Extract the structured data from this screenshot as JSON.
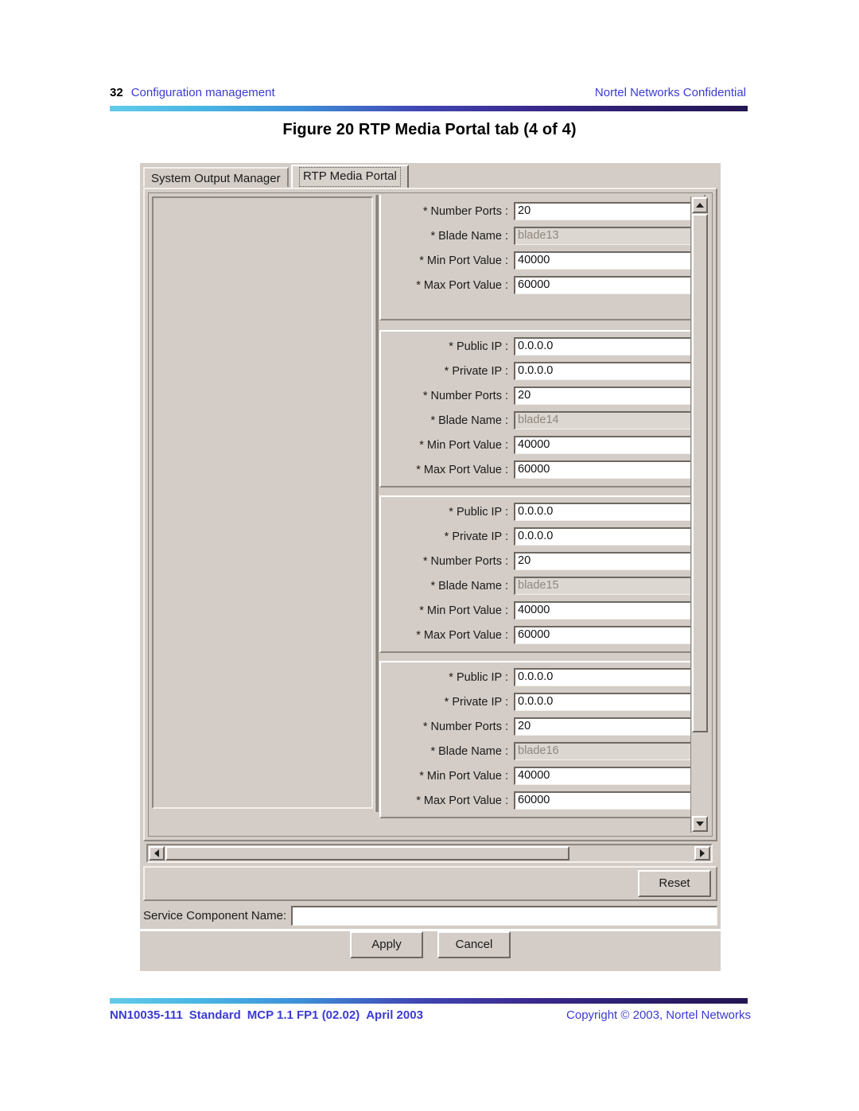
{
  "header": {
    "page_number": "32",
    "section": "Configuration management",
    "confidential": "Nortel Networks Confidential"
  },
  "figure": {
    "title": "Figure 20  RTP Media Portal tab (4 of 4)"
  },
  "window": {
    "tabs": [
      {
        "label": "System Output Manager",
        "selected": false
      },
      {
        "label": "RTP Media Portal",
        "selected": true
      }
    ],
    "groups": [
      {
        "blade": "blade13",
        "partial": true,
        "fields": [
          {
            "label": "* Number Ports :",
            "value": "20",
            "disabled": false
          },
          {
            "label": "* Blade Name :",
            "value": "blade13",
            "disabled": true
          },
          {
            "label": "* Min Port Value :",
            "value": "40000",
            "disabled": false
          },
          {
            "label": "* Max Port Value :",
            "value": "60000",
            "disabled": false
          }
        ]
      },
      {
        "blade": "blade14",
        "partial": false,
        "fields": [
          {
            "label": "* Public IP :",
            "value": "0.0.0.0",
            "disabled": false
          },
          {
            "label": "* Private IP :",
            "value": "0.0.0.0",
            "disabled": false
          },
          {
            "label": "* Number Ports :",
            "value": "20",
            "disabled": false
          },
          {
            "label": "* Blade Name :",
            "value": "blade14",
            "disabled": true
          },
          {
            "label": "* Min Port Value :",
            "value": "40000",
            "disabled": false
          },
          {
            "label": "* Max Port Value :",
            "value": "60000",
            "disabled": false
          }
        ]
      },
      {
        "blade": "blade15",
        "partial": false,
        "fields": [
          {
            "label": "* Public IP :",
            "value": "0.0.0.0",
            "disabled": false
          },
          {
            "label": "* Private IP :",
            "value": "0.0.0.0",
            "disabled": false
          },
          {
            "label": "* Number Ports :",
            "value": "20",
            "disabled": false
          },
          {
            "label": "* Blade Name :",
            "value": "blade15",
            "disabled": true
          },
          {
            "label": "* Min Port Value :",
            "value": "40000",
            "disabled": false
          },
          {
            "label": "* Max Port Value :",
            "value": "60000",
            "disabled": false
          }
        ]
      },
      {
        "blade": "blade16",
        "partial": false,
        "fields": [
          {
            "label": "* Public IP :",
            "value": "0.0.0.0",
            "disabled": false
          },
          {
            "label": "* Private IP :",
            "value": "0.0.0.0",
            "disabled": false
          },
          {
            "label": "* Number Ports :",
            "value": "20",
            "disabled": false
          },
          {
            "label": "* Blade Name :",
            "value": "blade16",
            "disabled": true
          },
          {
            "label": "* Min Port Value :",
            "value": "40000",
            "disabled": false
          },
          {
            "label": "* Max Port Value :",
            "value": "60000",
            "disabled": false
          }
        ]
      }
    ],
    "scrollbars": {
      "vertical": {
        "up_icon": "scroll-up-arrow-icon",
        "down_icon": "scroll-down-arrow-icon"
      },
      "horizontal": {
        "left_icon": "scroll-left-arrow-icon",
        "right_icon": "scroll-right-arrow-icon"
      }
    },
    "reset_label": "Reset",
    "service_component": {
      "label": "Service Component Name:",
      "value": "",
      "placeholder": ""
    },
    "apply_label": "Apply",
    "cancel_label": "Cancel"
  },
  "footer": {
    "doc_id": "NN10035-111",
    "standard": "Standard",
    "release": "MCP 1.1 FP1 (02.02)",
    "date": "April 2003",
    "copyright": "Copyright © 2003, Nortel Networks"
  },
  "colors": {
    "link_blue": "#3b3bd4",
    "window_grey": "#d4cdc7",
    "rule_start": "#63cbe9",
    "rule_end": "#241552"
  }
}
